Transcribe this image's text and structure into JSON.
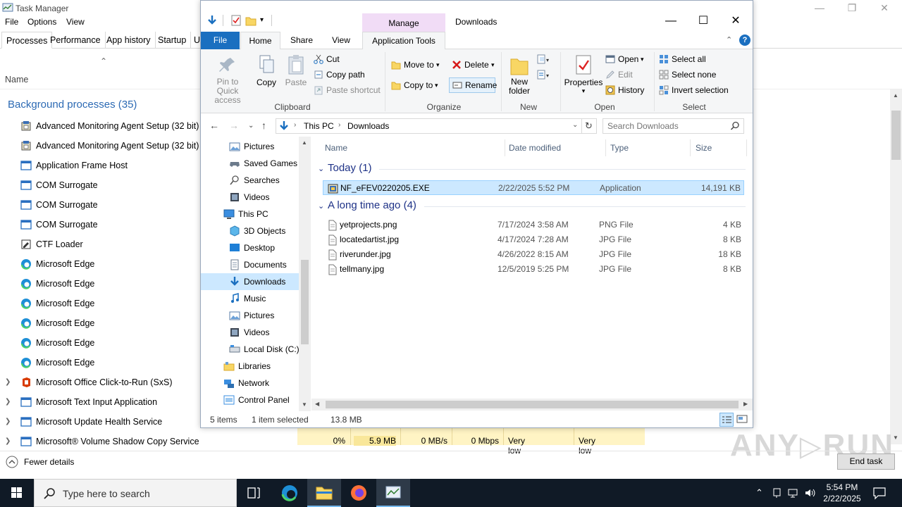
{
  "task_manager": {
    "title": "Task Manager",
    "menu": [
      "File",
      "Options",
      "View"
    ],
    "tabs": [
      "Processes",
      "Performance",
      "App history",
      "Startup",
      "U"
    ],
    "column_name": "Name",
    "group_title": "Background processes (35)",
    "processes": [
      {
        "name": "Advanced Monitoring Agent Setup (32 bit)",
        "icon": "installer-icon",
        "expandable": false
      },
      {
        "name": "Advanced Monitoring Agent Setup (32 bit)",
        "icon": "installer-icon",
        "expandable": false
      },
      {
        "name": "Application Frame Host",
        "icon": "app-window-icon",
        "expandable": false
      },
      {
        "name": "COM Surrogate",
        "icon": "app-window-icon",
        "expandable": false
      },
      {
        "name": "COM Surrogate",
        "icon": "app-window-icon",
        "expandable": false
      },
      {
        "name": "COM Surrogate",
        "icon": "app-window-icon",
        "expandable": false
      },
      {
        "name": "CTF Loader",
        "icon": "ctf-loader-icon",
        "expandable": false
      },
      {
        "name": "Microsoft Edge",
        "icon": "edge-icon",
        "expandable": false
      },
      {
        "name": "Microsoft Edge",
        "icon": "edge-icon",
        "expandable": false
      },
      {
        "name": "Microsoft Edge",
        "icon": "edge-icon",
        "expandable": false
      },
      {
        "name": "Microsoft Edge",
        "icon": "edge-icon",
        "expandable": false
      },
      {
        "name": "Microsoft Edge",
        "icon": "edge-icon",
        "expandable": false
      },
      {
        "name": "Microsoft Edge",
        "icon": "edge-icon",
        "expandable": false
      },
      {
        "name": "Microsoft Office Click-to-Run (SxS)",
        "icon": "office-icon",
        "expandable": true
      },
      {
        "name": "Microsoft Text Input Application",
        "icon": "app-window-icon",
        "expandable": true
      },
      {
        "name": "Microsoft Update Health Service",
        "icon": "app-window-icon",
        "expandable": true
      },
      {
        "name": "Microsoft® Volume Shadow Copy Service",
        "icon": "app-window-icon",
        "expandable": true
      }
    ],
    "stats": [
      "0%",
      "5.9 MB",
      "0 MB/s",
      "0 Mbps",
      "Very low",
      "Very low"
    ],
    "fewer_details": "Fewer details",
    "end_task": "End task",
    "watermark": "ANY RUN"
  },
  "explorer": {
    "window_title": "Downloads",
    "manage_label": "Manage",
    "ribbon_tabs": {
      "file": "File",
      "home": "Home",
      "share": "Share",
      "view": "View",
      "tools": "Application Tools"
    },
    "clipboard": {
      "pin": "Pin to Quick access",
      "copy": "Copy",
      "paste": "Paste",
      "cut": "Cut",
      "copy_path": "Copy path",
      "paste_shortcut": "Paste shortcut",
      "label": "Clipboard"
    },
    "organize": {
      "move_to": "Move to",
      "copy_to": "Copy to",
      "delete": "Delete",
      "rename": "Rename",
      "label": "Organize"
    },
    "new": {
      "new_folder": "New folder",
      "label": "New"
    },
    "open": {
      "properties": "Properties",
      "open": "Open",
      "edit": "Edit",
      "history": "History",
      "label": "Open"
    },
    "select": {
      "select_all": "Select all",
      "select_none": "Select none",
      "invert": "Invert selection",
      "label": "Select"
    },
    "breadcrumb": [
      "This PC",
      "Downloads"
    ],
    "search_placeholder": "Search Downloads",
    "nav_items": [
      {
        "label": "Pictures",
        "icon": "pictures-icon",
        "indent": 1,
        "selected": false
      },
      {
        "label": "Saved Games",
        "icon": "saved-games-icon",
        "indent": 1,
        "selected": false
      },
      {
        "label": "Searches",
        "icon": "search-icon",
        "indent": 1,
        "selected": false
      },
      {
        "label": "Videos",
        "icon": "videos-icon",
        "indent": 1,
        "selected": false
      },
      {
        "label": "This PC",
        "icon": "this-pc-icon",
        "indent": 0,
        "selected": false
      },
      {
        "label": "3D Objects",
        "icon": "3d-objects-icon",
        "indent": 1,
        "selected": false
      },
      {
        "label": "Desktop",
        "icon": "desktop-icon",
        "indent": 1,
        "selected": false
      },
      {
        "label": "Documents",
        "icon": "documents-icon",
        "indent": 1,
        "selected": false
      },
      {
        "label": "Downloads",
        "icon": "downloads-icon",
        "indent": 1,
        "selected": true
      },
      {
        "label": "Music",
        "icon": "music-icon",
        "indent": 1,
        "selected": false
      },
      {
        "label": "Pictures",
        "icon": "pictures-icon",
        "indent": 1,
        "selected": false
      },
      {
        "label": "Videos",
        "icon": "videos-icon",
        "indent": 1,
        "selected": false
      },
      {
        "label": "Local Disk (C:)",
        "icon": "local-disk-icon",
        "indent": 1,
        "selected": false
      },
      {
        "label": "Libraries",
        "icon": "libraries-icon",
        "indent": 0,
        "selected": false
      },
      {
        "label": "Network",
        "icon": "network-icon",
        "indent": 0,
        "selected": false
      },
      {
        "label": "Control Panel",
        "icon": "control-panel-icon",
        "indent": 0,
        "selected": false
      }
    ],
    "columns": [
      "Name",
      "Date modified",
      "Type",
      "Size"
    ],
    "groups": [
      {
        "title": "Today (1)",
        "files": [
          {
            "name": "NF_eFEV0220205.EXE",
            "date": "2/22/2025 5:52 PM",
            "type": "Application",
            "size": "14,191 KB",
            "icon": "exe-icon",
            "selected": true
          }
        ]
      },
      {
        "title": "A long time ago (4)",
        "files": [
          {
            "name": "yetprojects.png",
            "date": "7/17/2024 3:58 AM",
            "type": "PNG File",
            "size": "4 KB",
            "icon": "file-icon",
            "selected": false
          },
          {
            "name": "locatedartist.jpg",
            "date": "4/17/2024 7:28 AM",
            "type": "JPG File",
            "size": "8 KB",
            "icon": "file-icon",
            "selected": false
          },
          {
            "name": "riverunder.jpg",
            "date": "4/26/2022 8:15 AM",
            "type": "JPG File",
            "size": "18 KB",
            "icon": "file-icon",
            "selected": false
          },
          {
            "name": "tellmany.jpg",
            "date": "12/5/2019 5:25 PM",
            "type": "JPG File",
            "size": "8 KB",
            "icon": "file-icon",
            "selected": false
          }
        ]
      }
    ],
    "status": {
      "count": "5 items",
      "selected": "1 item selected",
      "size": "13.8 MB"
    }
  },
  "taskbar": {
    "search_placeholder": "Type here to search",
    "time": "5:54 PM",
    "date": "2/22/2025"
  },
  "colors": {
    "accent": "#1a6fc0",
    "manage_tab": "#f1dcf6",
    "selection": "#cce8ff",
    "group_title": "#2c6ab4",
    "stats_bg": "#fff4c4"
  }
}
